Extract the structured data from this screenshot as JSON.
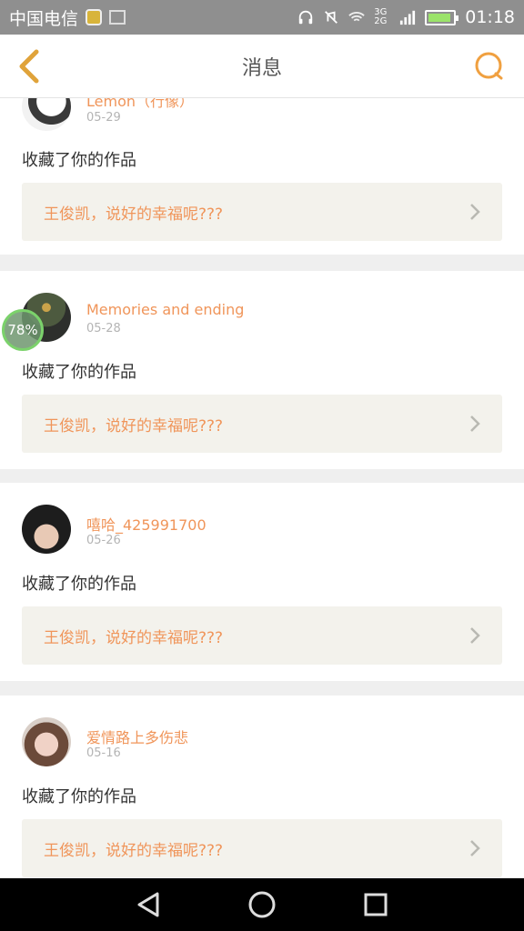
{
  "status_bar": {
    "carrier": "中国电信",
    "time": "01:18",
    "network": "3G 2G",
    "icons": [
      "app-notification-icon",
      "image-notification-icon",
      "headphones-icon",
      "mute-icon",
      "wifi-icon",
      "signal-icon",
      "battery-icon"
    ]
  },
  "header": {
    "title": "消息",
    "back_icon": "chevron-left-icon",
    "search_icon": "search-icon",
    "accent": "#f0a040"
  },
  "messages": [
    {
      "user": "Lemon（行像）",
      "date": "05-29",
      "action": "收藏了你的作品",
      "quote": "王俊凯，说好的幸福呢???"
    },
    {
      "user": "Memories and ending",
      "date": "05-28",
      "action": "收藏了你的作品",
      "quote": "王俊凯，说好的幸福呢???"
    },
    {
      "user": "嘻哈_425991700",
      "date": "05-26",
      "action": "收藏了你的作品",
      "quote": "王俊凯，说好的幸福呢???"
    },
    {
      "user": "爱情路上多伤悲",
      "date": "05-16",
      "action": "收藏了你的作品",
      "quote": "王俊凯，说好的幸福呢???"
    }
  ],
  "float_badge": {
    "text": "78%"
  },
  "colors": {
    "name": "#f0955a",
    "quote_bg": "#f3f2ec",
    "divider": "#efefef"
  },
  "navbar": {
    "icons": [
      "back-triangle-icon",
      "home-circle-icon",
      "recents-square-icon"
    ]
  }
}
